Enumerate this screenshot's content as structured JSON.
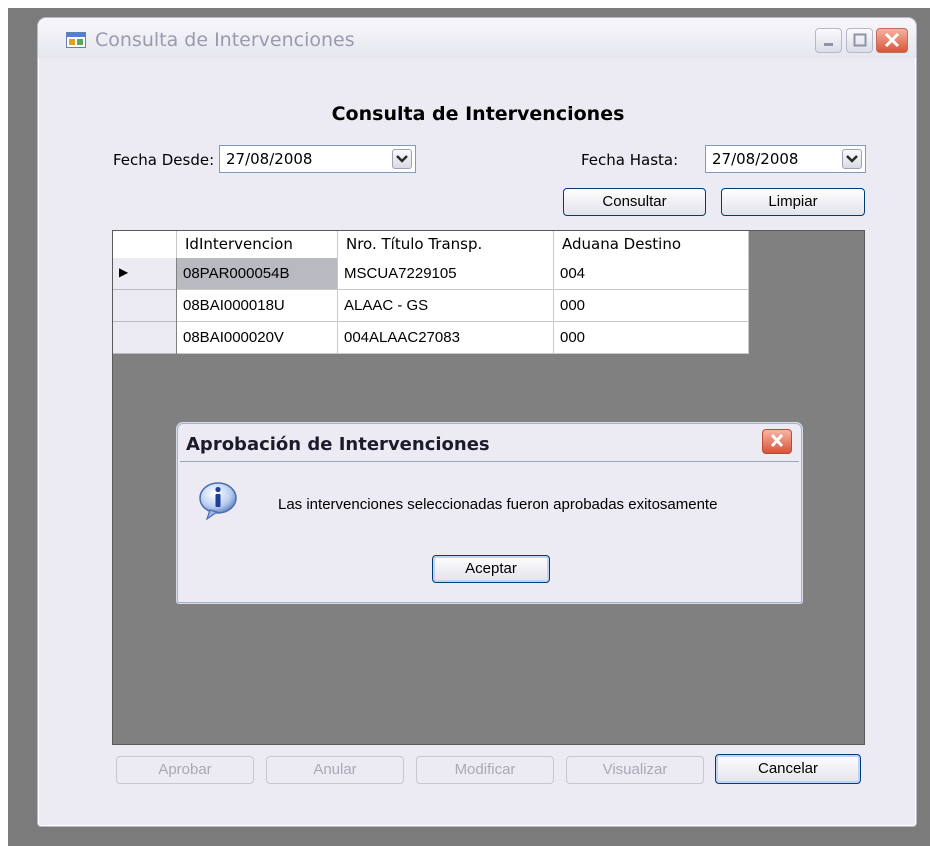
{
  "window": {
    "title": "Consulta de Intervenciones",
    "heading": "Consulta de Intervenciones"
  },
  "filters": {
    "desde_label": "Fecha Desde:",
    "desde_value": "27/08/2008",
    "hasta_label": "Fecha Hasta:",
    "hasta_value": "27/08/2008"
  },
  "actions": {
    "consultar": "Consultar",
    "limpiar": "Limpiar"
  },
  "grid": {
    "columns": [
      "IdIntervencion",
      "Nro. Título Transp.",
      "Aduana Destino"
    ],
    "rows": [
      [
        "08PAR000054B",
        "MSCUA7229105",
        "004"
      ],
      [
        "08BAI000018U",
        "ALAAC - GS",
        "000"
      ],
      [
        "08BAI000020V",
        "004ALAAC27083",
        "000"
      ]
    ],
    "current_row_marker": "▶"
  },
  "dialog": {
    "title": "Aprobación de Intervenciones",
    "message": "Las intervenciones seleccionadas fueron aprobadas exitosamente",
    "ok": "Aceptar"
  },
  "footer": {
    "aprobar": "Aprobar",
    "anular": "Anular",
    "modificar": "Modificar",
    "visualizar": "Visualizar",
    "cancelar": "Cancelar"
  },
  "icons": {
    "app": "form-app-icon",
    "dialog": "info-icon"
  }
}
